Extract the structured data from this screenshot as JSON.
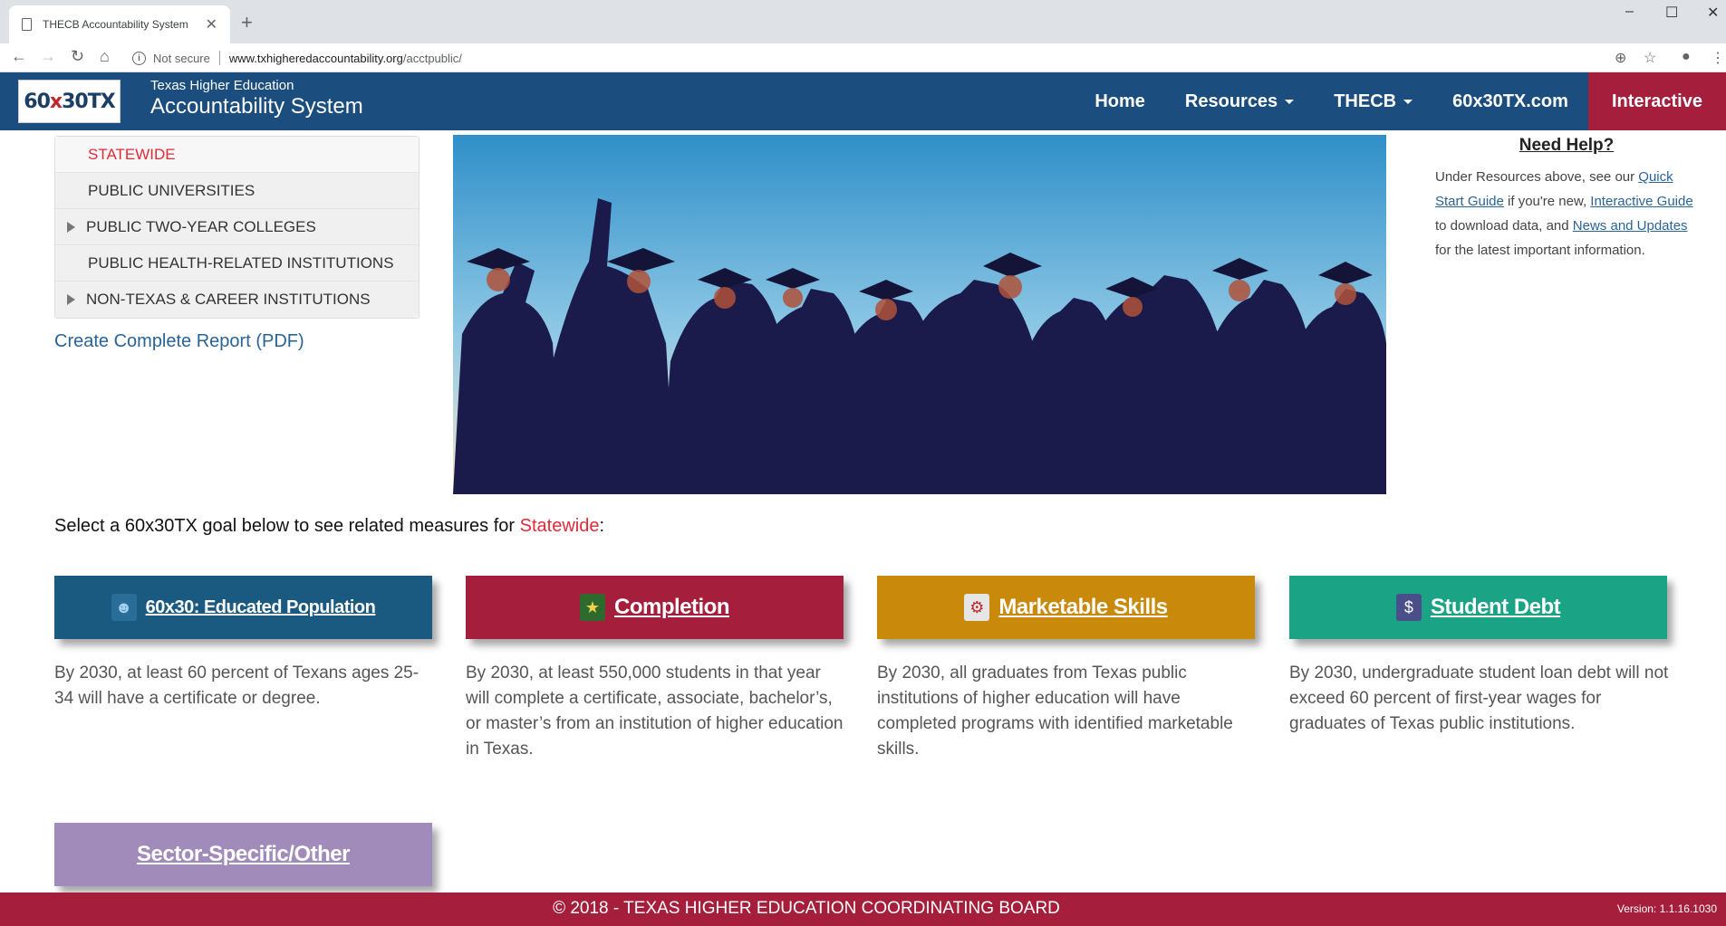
{
  "browser": {
    "tab_title": "THECB Accountability System",
    "new_tab": "+",
    "url_security": "Not secure",
    "url_host": "www.txhigheredaccountability.org",
    "url_path": "/acctpublic/"
  },
  "header": {
    "logo_text_a": "60",
    "logo_text_b": "x",
    "logo_text_c": "30TX",
    "brand_small": "Texas Higher Education",
    "brand_big": "Accountability System",
    "nav": {
      "home": "Home",
      "resources": "Resources",
      "thecb": "THECB",
      "site": "60x30TX.com",
      "interactive": "Interactive"
    }
  },
  "sidebar": {
    "items": [
      {
        "label": "STATEWIDE"
      },
      {
        "label": "PUBLIC UNIVERSITIES"
      },
      {
        "label": "PUBLIC TWO-YEAR COLLEGES"
      },
      {
        "label": "PUBLIC HEALTH-RELATED INSTITUTIONS"
      },
      {
        "label": "NON-TEXAS & CAREER INSTITUTIONS"
      }
    ],
    "pdf_link": "Create Complete Report (PDF)"
  },
  "help": {
    "title": "Need Help?",
    "t1": "Under Resources above, see our ",
    "l1": "Quick Start Guide",
    "t2": " if you're new, ",
    "l2": "Interactive Guide",
    "t3": " to download data, and ",
    "l3": "News and Updates",
    "t4": " for the latest important information."
  },
  "goals": {
    "prompt": "Select a 60x30TX goal below to see related measures for ",
    "selected": "Statewide",
    "colon": ":",
    "educated": {
      "label": "60x30: Educated Population",
      "desc": "By 2030, at least 60 percent of Texans ages 25-34 will have a certificate or degree."
    },
    "completion": {
      "label": "Completion",
      "desc": "By 2030, at least 550,000 students in that year will complete a certificate, associate, bachelor’s, or master’s from an institution of higher education in Texas."
    },
    "skills": {
      "label": "Marketable Skills",
      "desc": "By 2030, all graduates from Texas public institutions of higher education will have completed programs with identified marketable skills."
    },
    "debt": {
      "label": "Student Debt",
      "desc": "By 2030, undergraduate student loan debt will not exceed 60 percent of first-year wages for graduates of Texas public institutions."
    },
    "sector": {
      "label": "Sector-Specific/Other"
    }
  },
  "footer": {
    "copyright": "© 2018 - TEXAS HIGHER EDUCATION COORDINATING BOARD",
    "version": "Version: 1.1.16.1030"
  },
  "colors": {
    "header_bg": "#1b4e7e",
    "accent_red": "#a51e3c",
    "educated": "#1b5a80",
    "completion": "#a51e3c",
    "skills": "#c9890a",
    "debt": "#1aa384",
    "sector": "#a08bbb"
  }
}
